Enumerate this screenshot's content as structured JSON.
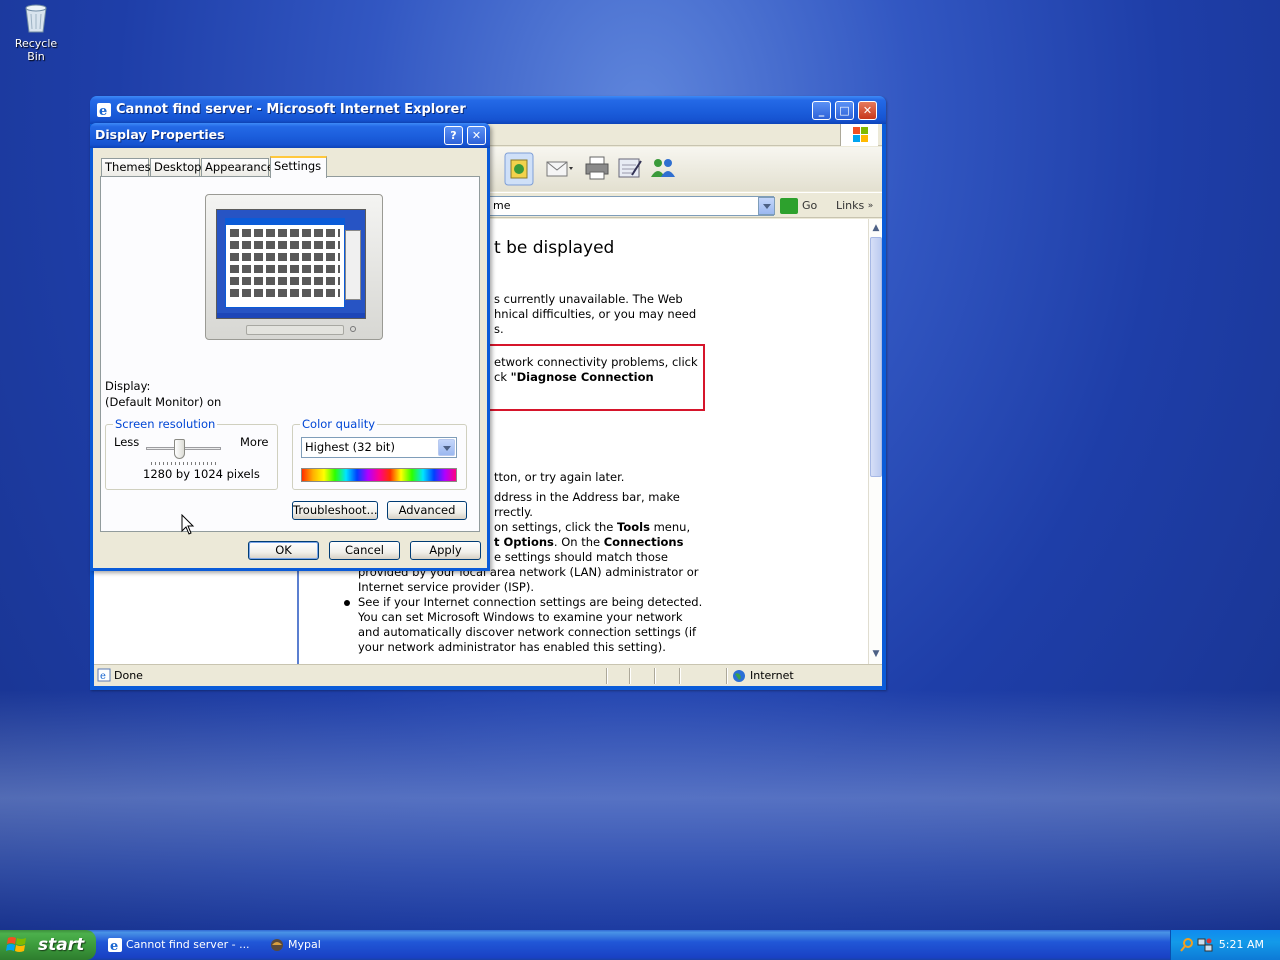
{
  "desktop": {
    "recycle_bin_label": "Recycle Bin",
    "background_color": "#2a4db8"
  },
  "ie_window": {
    "title": "Cannot find server - Microsoft Internet Explorer",
    "address_value": "me",
    "go_label": "Go",
    "links_label": "Links",
    "page": {
      "heading": "t be displayed",
      "p1_l1": "s currently unavailable. The Web",
      "p1_l2": "hnical difficulties, or you may need",
      "p1_l3": "s.",
      "box_l1": "etwork connectivity problems, click",
      "box_l2_a": "ck ",
      "box_l2_b": "\"Diagnose Connection",
      "l_try": "tton, or try again later.",
      "l_addr1": "ddress in the Address bar, make",
      "l_addr2": "rrectly.",
      "l_set1_a": "on settings, click the ",
      "l_set1_b": "Tools",
      "l_set1_c": " menu,",
      "l_set2_a": "t Options",
      "l_set2_b": ". On the ",
      "l_set2_c": "Connections",
      "l_set3": "e settings should match those",
      "l_set4": "provided by your local area network (LAN) administrator or",
      "l_set5": "Internet service provider (ISP).",
      "b2_l1": "See if your Internet connection settings are being detected.",
      "b2_l2": "You can set Microsoft Windows to examine your network",
      "b2_l3": "and automatically discover network connection settings (if",
      "b2_l4": "your network administrator has enabled this setting)."
    },
    "status_text": "Done",
    "zone_text": "Internet"
  },
  "dialog": {
    "title": "Display Properties",
    "tabs": [
      "Themes",
      "Desktop",
      "Appearance",
      "Settings"
    ],
    "active_tab": "Settings",
    "display_label": "Display:",
    "display_value": "(Default Monitor) on",
    "screen_resolution": {
      "legend": "Screen resolution",
      "less": "Less",
      "more": "More",
      "value": "1280 by 1024 pixels"
    },
    "color_quality": {
      "legend": "Color quality",
      "selected": "Highest (32 bit)"
    },
    "buttons": {
      "troubleshoot": "Troubleshoot...",
      "advanced": "Advanced",
      "ok": "OK",
      "cancel": "Cancel",
      "apply": "Apply"
    }
  },
  "taskbar": {
    "start_label": "start",
    "tasks": [
      "Cannot find server - ...",
      "Mypal"
    ],
    "clock": "5:21 AM"
  },
  "colors": {
    "xp_blue": "#0a5bd8",
    "start_green": "#3c9c3c",
    "tab_highlight": "#ffc83c",
    "error_box": "#d6152b"
  }
}
